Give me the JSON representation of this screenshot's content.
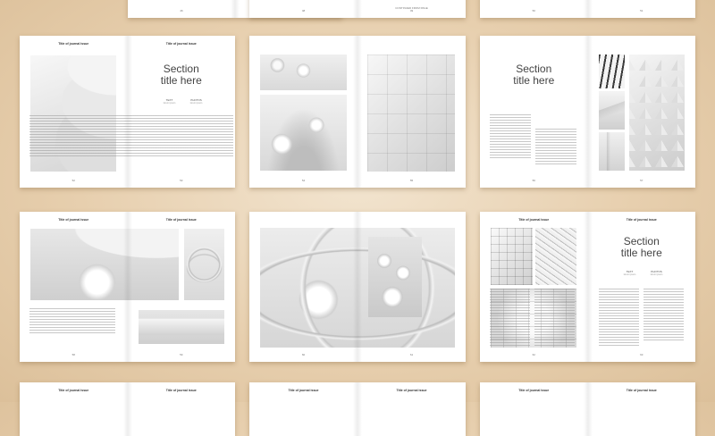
{
  "running_head": "Title of journal issue",
  "section_title": "Section\ntitle here",
  "meta": {
    "left_label": "TEXT",
    "left_sub": "lorem ipsum",
    "right_label": "PHOTOS",
    "right_sub": "lorem ipsum"
  },
  "top_row_caption": "CONTINUED FROM PAGE",
  "folios": {
    "r2_s1_left": "52",
    "r2_s1_right": "53",
    "r2_s2_left": "54",
    "r2_s2_right": "55",
    "r2_s3_left": "56",
    "r2_s3_right": "57",
    "r3_s1_left": "58",
    "r3_s1_right": "59",
    "r3_s2_left": "60",
    "r3_s2_right": "61",
    "r3_s3_left": "62",
    "r3_s3_right": "63",
    "r1_s1_left": "46",
    "r1_s1_right": "47",
    "r1_s2_left": "48",
    "r1_s2_right": "49",
    "r1_s3_left": "50",
    "r1_s3_right": "51"
  },
  "colors": {
    "background": "#e7cfae",
    "page": "#ffffff",
    "title_text": "#444444"
  }
}
